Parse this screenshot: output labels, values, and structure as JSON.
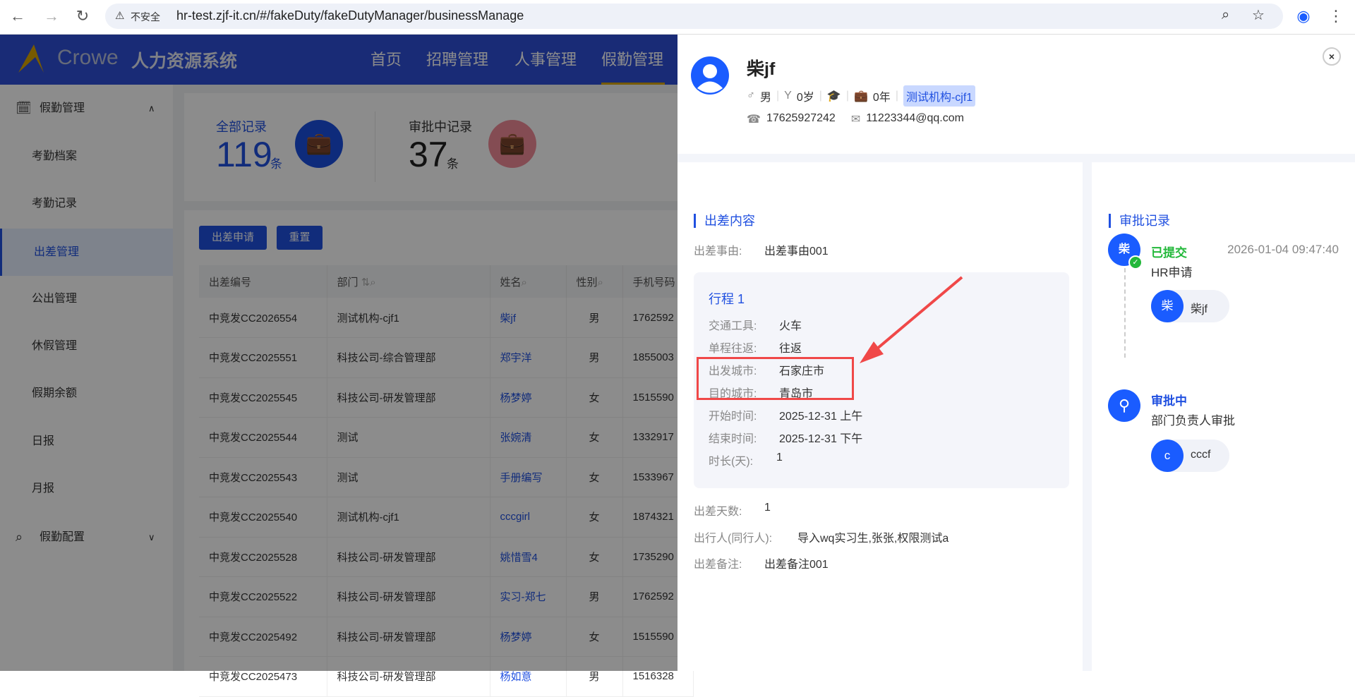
{
  "browser": {
    "insecure": "不安全",
    "url": "hr-test.zjf-it.cn/#/fakeDuty/fakeDutyManager/businessManage"
  },
  "header": {
    "logo": "Crowe",
    "system": "人力资源系统",
    "nav": [
      "首页",
      "招聘管理",
      "人事管理",
      "假勤管理"
    ],
    "active": "假勤管理"
  },
  "sidebar": {
    "group1": "假勤管理",
    "items": [
      "考勤档案",
      "考勤记录",
      "出差管理",
      "公出管理",
      "休假管理",
      "假期余额",
      "日报",
      "月报"
    ],
    "active": "出差管理",
    "group2": "假勤配置"
  },
  "stats": {
    "all_label": "全部记录",
    "all_count": "119",
    "unit": "条",
    "pending_label": "审批中记录",
    "pending_count": "37"
  },
  "toolbar": {
    "apply": "出差申请",
    "reset": "重置"
  },
  "table": {
    "headers": [
      "出差编号",
      "部门",
      "姓名",
      "性别",
      "手机号码"
    ],
    "rows": [
      [
        "中竞发CC2026554",
        "测试机构-cjf1",
        "柴jf",
        "男",
        "1762592"
      ],
      [
        "中竞发CC2025551",
        "科技公司-综合管理部",
        "郑宇洋",
        "男",
        "1855003"
      ],
      [
        "中竞发CC2025545",
        "科技公司-研发管理部",
        "杨梦婷",
        "女",
        "1515590"
      ],
      [
        "中竞发CC2025544",
        "测试",
        "张婉清",
        "女",
        "1332917"
      ],
      [
        "中竞发CC2025543",
        "测试",
        "手册编写",
        "女",
        "1533967"
      ],
      [
        "中竞发CC2025540",
        "测试机构-cjf1",
        "cccgirl",
        "女",
        "1874321"
      ],
      [
        "中竞发CC2025528",
        "科技公司-研发管理部",
        "姚惜雪4",
        "女",
        "1735290"
      ],
      [
        "中竞发CC2025522",
        "科技公司-研发管理部",
        "实习-郑七",
        "男",
        "1762592"
      ],
      [
        "中竞发CC2025492",
        "科技公司-研发管理部",
        "杨梦婷",
        "女",
        "1515590"
      ],
      [
        "中竞发CC2025473",
        "科技公司-研发管理部",
        "杨如意",
        "男",
        "1516328"
      ]
    ]
  },
  "drawer": {
    "name": "柴jf",
    "gender": "男",
    "age": "0岁",
    "years": "0年",
    "org": "测试机构-cjf1",
    "phone": "17625927242",
    "email": "11223344@qq.com",
    "content": {
      "title": "出差内容",
      "reason_label": "出差事由:",
      "reason": "出差事由001",
      "trip": {
        "title": "行程 1",
        "fields": [
          [
            "交通工具:",
            "火车"
          ],
          [
            "单程往返:",
            "往返"
          ],
          [
            "出发城市:",
            "石家庄市"
          ],
          [
            "目的城市:",
            "青岛市"
          ],
          [
            "开始时间:",
            "2025-12-31 上午"
          ],
          [
            "结束时间:",
            "2025-12-31 下午"
          ],
          [
            "时长(天):",
            "1"
          ]
        ]
      },
      "days_label": "出差天数:",
      "days": "1",
      "companions_label": "出行人(同行人):",
      "companions": "导入wq实习生,张张,权限测试a",
      "remark_label": "出差备注:",
      "remark": "出差备注001"
    },
    "approval": {
      "title": "审批记录",
      "steps": [
        {
          "avatar": "柴",
          "status": "已提交",
          "time": "2026-01-04 09:47:40",
          "desc": "HR申请",
          "person_avatar": "柴",
          "person": "柴jf"
        },
        {
          "status": "审批中",
          "desc": "部门负责人审批",
          "person_avatar": "c",
          "person": "cccf"
        }
      ]
    }
  },
  "colors": {
    "primary": "#2050e0",
    "success": "#22b83a",
    "highlight": "#f04848",
    "gold": "#d9a400"
  }
}
